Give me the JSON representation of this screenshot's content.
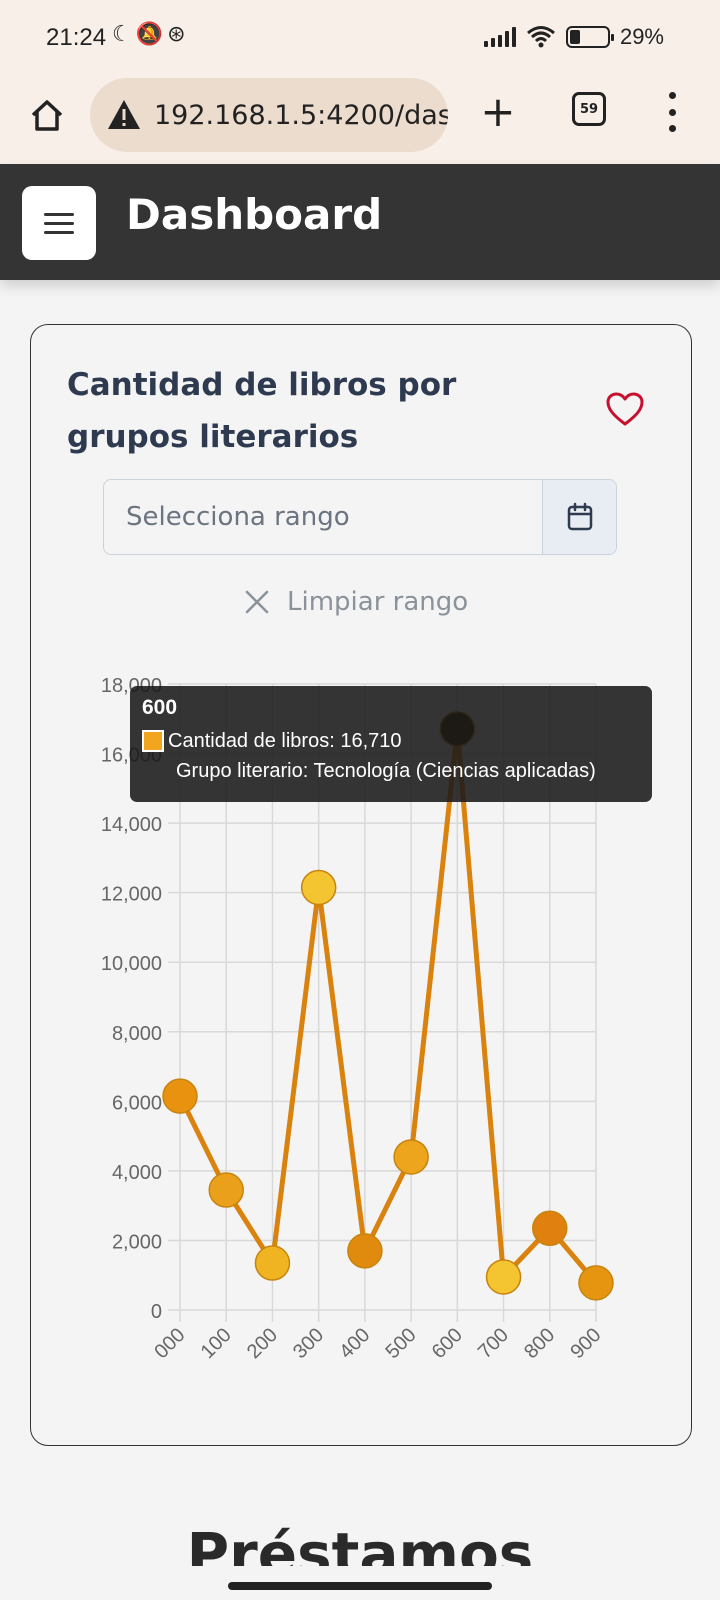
{
  "status_bar": {
    "time": "21:24",
    "icons": [
      "moon-icon",
      "mute-icon",
      "sync-icon",
      "signal-icon",
      "wifi-icon",
      "battery-icon"
    ],
    "battery_level": 0.29,
    "battery_text": "29%"
  },
  "browser": {
    "url": "192.168.1.5:4200/das",
    "tab_count": "59"
  },
  "app_header": {
    "title": "Dashboard"
  },
  "card": {
    "title": "Cantidad de libros por grupos literarios",
    "range_placeholder": "Selecciona rango",
    "clear_label": "Limpiar rango"
  },
  "chart_data": {
    "type": "line",
    "categories": [
      "000",
      "100",
      "200",
      "300",
      "400",
      "500",
      "600",
      "700",
      "800",
      "900"
    ],
    "series": [
      {
        "name": "Cantidad de libros",
        "values": [
          6150,
          3450,
          1350,
          12150,
          1700,
          4400,
          16710,
          950,
          2350,
          780
        ]
      }
    ],
    "yticks": [
      "0",
      "2,000",
      "4,000",
      "6,000",
      "8,000",
      "10,000",
      "12,000",
      "14,000",
      "16,000",
      "18,000"
    ],
    "ylim": [
      0,
      18000
    ],
    "grid": true,
    "line_color": "#d9820e",
    "point_colors": [
      "#e8920f",
      "#eaa01a",
      "#f0b422",
      "#f5c531",
      "#e08a0e",
      "#eda51d",
      "#3b2600",
      "#f5c531",
      "#e0800e",
      "#e59510"
    ],
    "highlighted_index": 6,
    "tooltip": {
      "title": "600",
      "value_label": "Cantidad de libros: 16,710",
      "group_label": "Grupo literario: Tecnología (Ciencias aplicadas)"
    }
  },
  "next_section": {
    "title": "Préstamos"
  }
}
